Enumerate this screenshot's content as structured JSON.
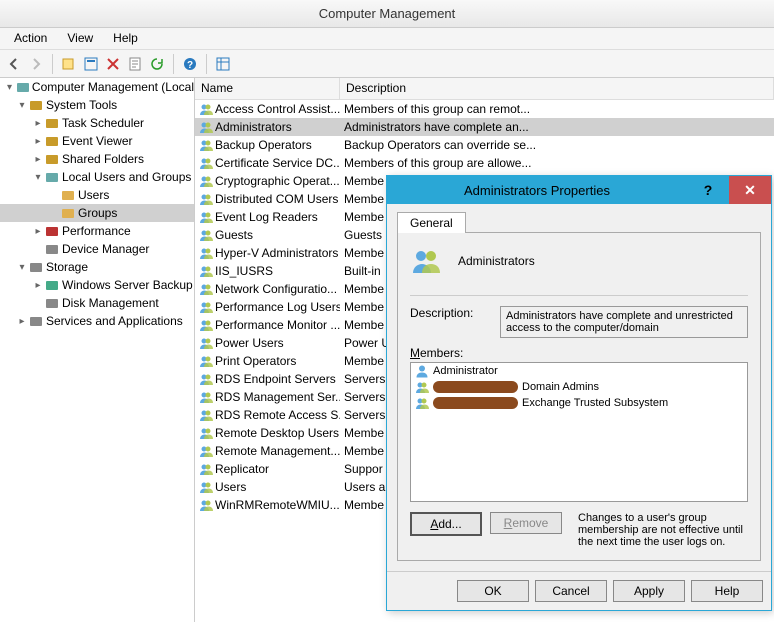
{
  "window_title": "Computer Management",
  "menu": {
    "action": "Action",
    "view": "View",
    "help": "Help"
  },
  "tree": {
    "root": "Computer Management (Local",
    "system_tools": "System Tools",
    "task_scheduler": "Task Scheduler",
    "event_viewer": "Event Viewer",
    "shared_folders": "Shared Folders",
    "local_users": "Local Users and Groups",
    "users": "Users",
    "groups": "Groups",
    "performance": "Performance",
    "device_manager": "Device Manager",
    "storage": "Storage",
    "server_backup": "Windows Server Backup",
    "disk_mgmt": "Disk Management",
    "services_apps": "Services and Applications"
  },
  "columns": {
    "name": "Name",
    "desc": "Description"
  },
  "groups": [
    {
      "name": "Access Control Assist...",
      "desc": "Members of this group can remot..."
    },
    {
      "name": "Administrators",
      "desc": "Administrators have complete an..."
    },
    {
      "name": "Backup Operators",
      "desc": "Backup Operators can override se..."
    },
    {
      "name": "Certificate Service DC...",
      "desc": "Members of this group are allowe..."
    },
    {
      "name": "Cryptographic Operat...",
      "desc": "Membe"
    },
    {
      "name": "Distributed COM Users",
      "desc": "Membe"
    },
    {
      "name": "Event Log Readers",
      "desc": "Membe"
    },
    {
      "name": "Guests",
      "desc": "Guests"
    },
    {
      "name": "Hyper-V Administrators",
      "desc": "Membe"
    },
    {
      "name": "IIS_IUSRS",
      "desc": "Built-in"
    },
    {
      "name": "Network Configuratio...",
      "desc": "Membe"
    },
    {
      "name": "Performance Log Users",
      "desc": "Membe"
    },
    {
      "name": "Performance Monitor ...",
      "desc": "Membe"
    },
    {
      "name": "Power Users",
      "desc": "Power U"
    },
    {
      "name": "Print Operators",
      "desc": "Membe"
    },
    {
      "name": "RDS Endpoint Servers",
      "desc": "Servers"
    },
    {
      "name": "RDS Management Ser...",
      "desc": "Servers"
    },
    {
      "name": "RDS Remote Access S...",
      "desc": "Servers"
    },
    {
      "name": "Remote Desktop Users",
      "desc": "Membe"
    },
    {
      "name": "Remote Management...",
      "desc": "Membe"
    },
    {
      "name": "Replicator",
      "desc": "Suppor"
    },
    {
      "name": "Users",
      "desc": "Users ar"
    },
    {
      "name": "WinRMRemoteWMIU...",
      "desc": "Membe"
    }
  ],
  "selected_group_index": 1,
  "dialog": {
    "title": "Administrators Properties",
    "tab": "General",
    "group_name": "Administrators",
    "desc_label": "Description:",
    "desc_value": "Administrators have complete and unrestricted access to the computer/domain",
    "members_label": "Members:",
    "members": [
      {
        "icon": "user",
        "redact": false,
        "name": "Administrator"
      },
      {
        "icon": "group",
        "redact": true,
        "name": "Domain Admins"
      },
      {
        "icon": "group",
        "redact": true,
        "name": "Exchange Trusted Subsystem"
      }
    ],
    "add": "Add...",
    "remove": "Remove",
    "note": "Changes to a user's group membership are not effective until the next time the user logs on.",
    "ok": "OK",
    "cancel": "Cancel",
    "apply": "Apply",
    "help": "Help"
  }
}
